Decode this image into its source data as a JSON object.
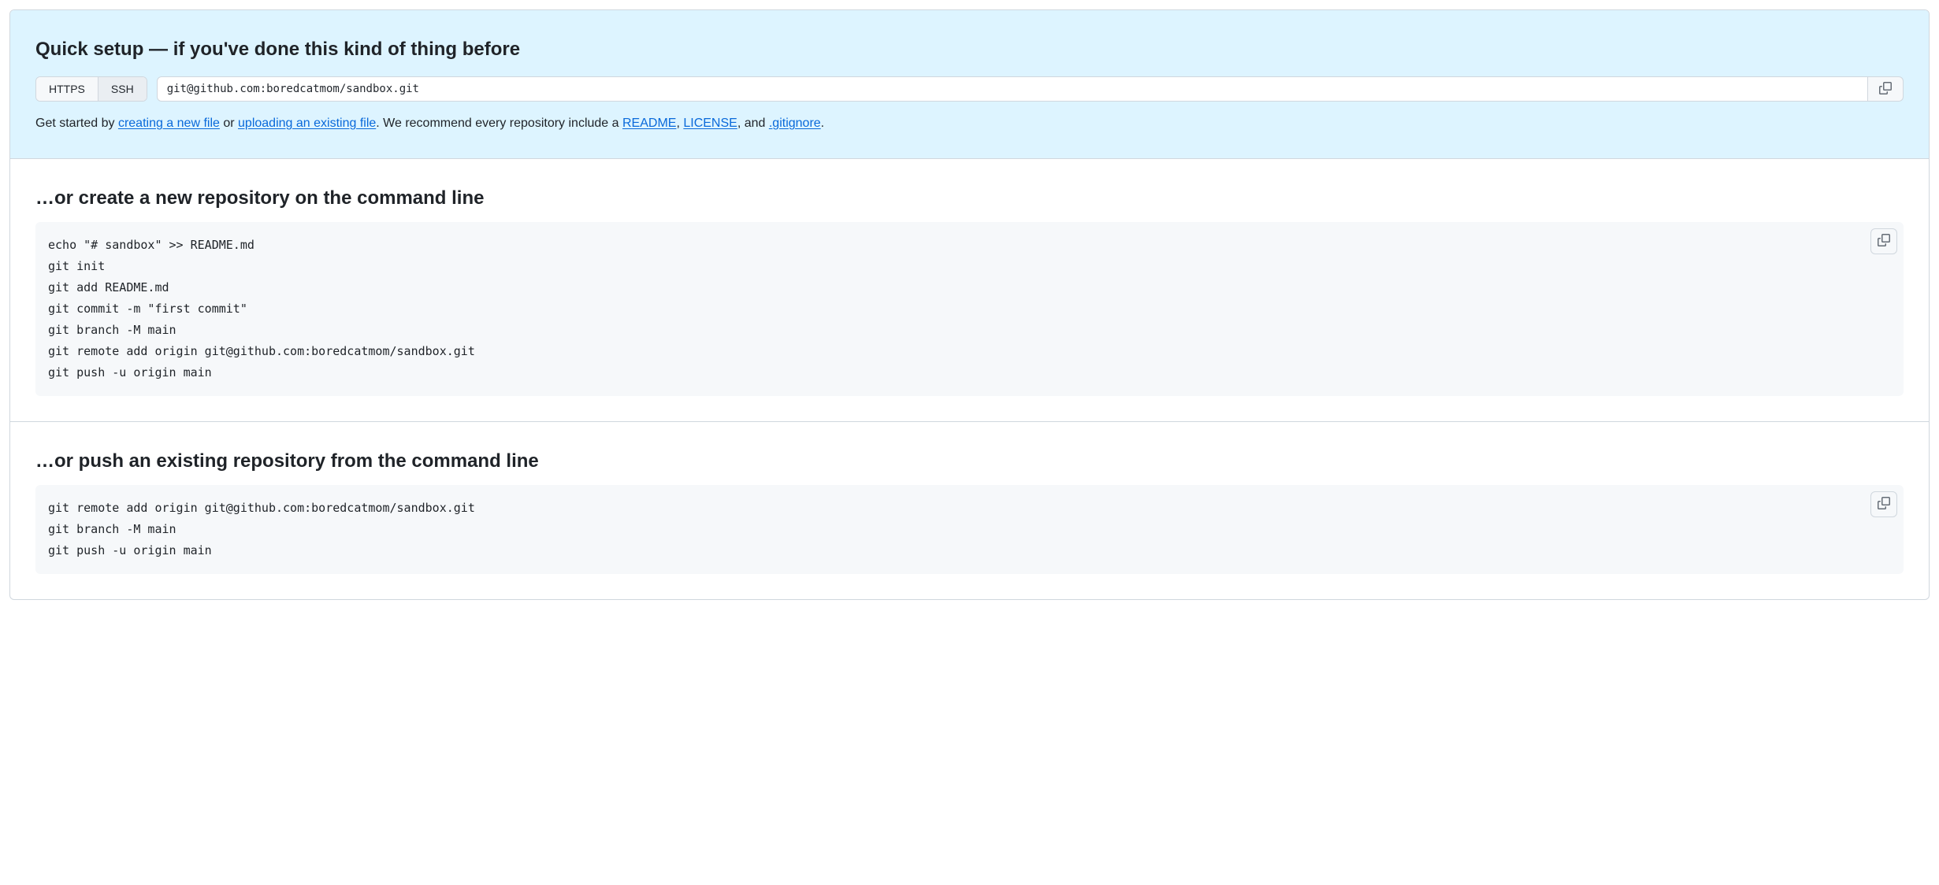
{
  "quick_setup": {
    "heading": "Quick setup — if you've done this kind of thing before",
    "tabs": {
      "https": "HTTPS",
      "ssh": "SSH"
    },
    "clone_url": "git@github.com:boredcatmom/sandbox.git",
    "help": {
      "prefix": "Get started by ",
      "create_file": "creating a new file",
      "or": " or ",
      "upload_file": "uploading an existing file",
      "after_upload": ". We recommend every repository include a ",
      "readme": "README",
      "comma": ", ",
      "license": "LICENSE",
      "and": ", and ",
      "gitignore": ".gitignore",
      "period": "."
    }
  },
  "create_repo": {
    "heading": "…or create a new repository on the command line",
    "commands": "echo \"# sandbox\" >> README.md\ngit init\ngit add README.md\ngit commit -m \"first commit\"\ngit branch -M main\ngit remote add origin git@github.com:boredcatmom/sandbox.git\ngit push -u origin main"
  },
  "push_repo": {
    "heading": "…or push an existing repository from the command line",
    "commands": "git remote add origin git@github.com:boredcatmom/sandbox.git\ngit branch -M main\ngit push -u origin main"
  }
}
